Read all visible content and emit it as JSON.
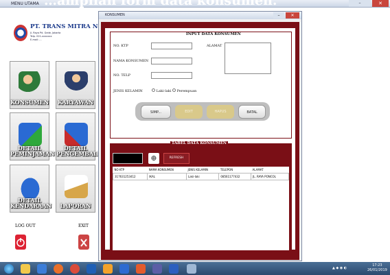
{
  "doc_heading": "…ampilan form data konsumen.",
  "main_window": {
    "title": "MENU UTAMA",
    "controls": [
      "–",
      "✕"
    ]
  },
  "company": {
    "name": "PT. TRANS MITRA NUSANTARA",
    "address_lines": [
      "Jl. Raya Pd. Gede, Jakarta",
      "Telp. 021-xxxxxxx",
      "E-mail: ..."
    ]
  },
  "menu": {
    "konsumen": "KONSUMEN",
    "karyawan": "KARYAWAN",
    "detail_peminjaman": [
      "DETAIL",
      "PEMINJAMAN"
    ],
    "detail_pengembalian": [
      "DETAIL",
      "PENGEMBALIAN"
    ],
    "detail_kendaraan": [
      "DETAIL",
      "KENDARAAN"
    ],
    "laporan": "LAPORAN",
    "log_out": "LOG OUT",
    "exit": "EXIT"
  },
  "child_window": {
    "title": "KONSUMEN",
    "controls": [
      "–",
      "✕"
    ]
  },
  "form": {
    "title": "INPUT DATA KONSUMEN",
    "labels": {
      "no_ktp": "NO. KTP",
      "nama": "NAMA KONSUMEN",
      "telp": "NO. TELP",
      "jenis_kelamin": "JENIS KELAMIN",
      "alamat": "ALAMAT"
    },
    "values": {
      "no_ktp": "",
      "nama": "",
      "telp": "",
      "alamat": ""
    },
    "gender_options": [
      "Laki-laki",
      "Perempuan"
    ],
    "buttons": {
      "simpan": "SIMP...",
      "edit": "EDIT",
      "hapus": "HAPUS",
      "batal": "BATAL"
    }
  },
  "table": {
    "title": "TABEL DATA KONSUMEN",
    "search_value": "",
    "refresh_label": "REFRESH",
    "columns": [
      "NO KTP",
      "NAMA KONSUMEN",
      "JENIS KELAMIN",
      "TELEPON",
      "ALAMAT"
    ],
    "rows": [
      [
        "317631253412",
        "IKAL",
        "Laki-laki",
        "08561177432",
        "JL. RAYA PONCOL"
      ]
    ]
  },
  "taskbar": {
    "time": "17:23",
    "date": "26/01/2019"
  },
  "colors": {
    "maroon": "#7a0f16",
    "titlebar": "#cfd9e8",
    "taskbar": "#2b4a6e"
  }
}
